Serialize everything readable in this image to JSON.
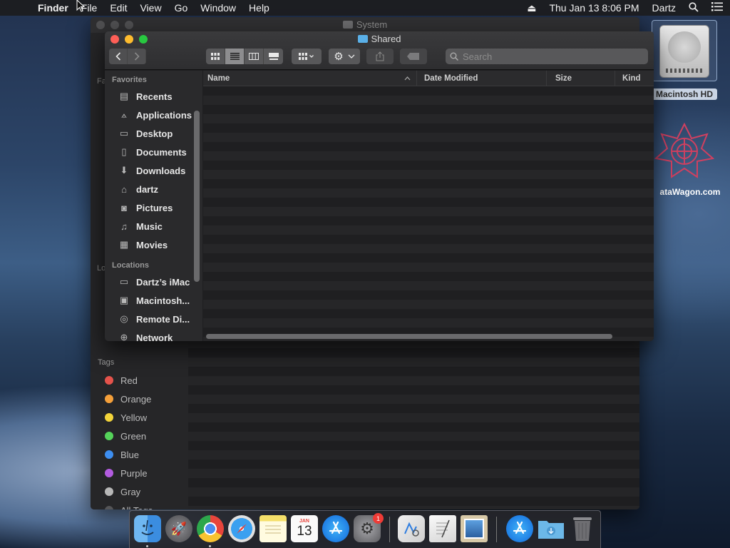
{
  "menubar": {
    "app": "Finder",
    "items": [
      "File",
      "Edit",
      "View",
      "Go",
      "Window",
      "Help"
    ],
    "clock": "Thu Jan 13  8:06 PM",
    "user": "Dartz"
  },
  "desktop": {
    "hd_label": "Macintosh HD",
    "datawagon_label": "ataWagon.com"
  },
  "back_window": {
    "title": "System",
    "tags_header": "Tags",
    "tags": [
      {
        "label": "Red",
        "color": "#e5534b"
      },
      {
        "label": "Orange",
        "color": "#f5a03a"
      },
      {
        "label": "Yellow",
        "color": "#f3d43a"
      },
      {
        "label": "Green",
        "color": "#55d35a"
      },
      {
        "label": "Blue",
        "color": "#3d8ef0"
      },
      {
        "label": "Purple",
        "color": "#b35ce0"
      },
      {
        "label": "Gray",
        "color": "#b7b7b7"
      },
      {
        "label": "All Tags...",
        "color": "#555557"
      }
    ]
  },
  "front_window": {
    "title": "Shared",
    "search_placeholder": "Search",
    "sidebar": {
      "favorites_header": "Favorites",
      "favorites": [
        {
          "label": "Recents",
          "icon": "recents-icon"
        },
        {
          "label": "Applications",
          "icon": "applications-icon"
        },
        {
          "label": "Desktop",
          "icon": "desktop-icon"
        },
        {
          "label": "Documents",
          "icon": "documents-icon"
        },
        {
          "label": "Downloads",
          "icon": "downloads-icon"
        },
        {
          "label": "dartz",
          "icon": "home-icon"
        },
        {
          "label": "Pictures",
          "icon": "camera-icon"
        },
        {
          "label": "Music",
          "icon": "music-note-icon"
        },
        {
          "label": "Movies",
          "icon": "film-icon"
        }
      ],
      "locations_header": "Locations",
      "locations": [
        {
          "label": "Dartz’s iMac",
          "icon": "computer-icon"
        },
        {
          "label": "Macintosh...",
          "icon": "hard-drive-icon"
        },
        {
          "label": "Remote Di...",
          "icon": "disc-icon"
        },
        {
          "label": "Network",
          "icon": "network-icon"
        }
      ]
    },
    "columns": {
      "name": "Name",
      "date_modified": "Date Modified",
      "size": "Size",
      "kind": "Kind"
    }
  },
  "dock": {
    "calendar_month": "JAN",
    "calendar_day": "13",
    "sysprefs_badge": "1"
  }
}
